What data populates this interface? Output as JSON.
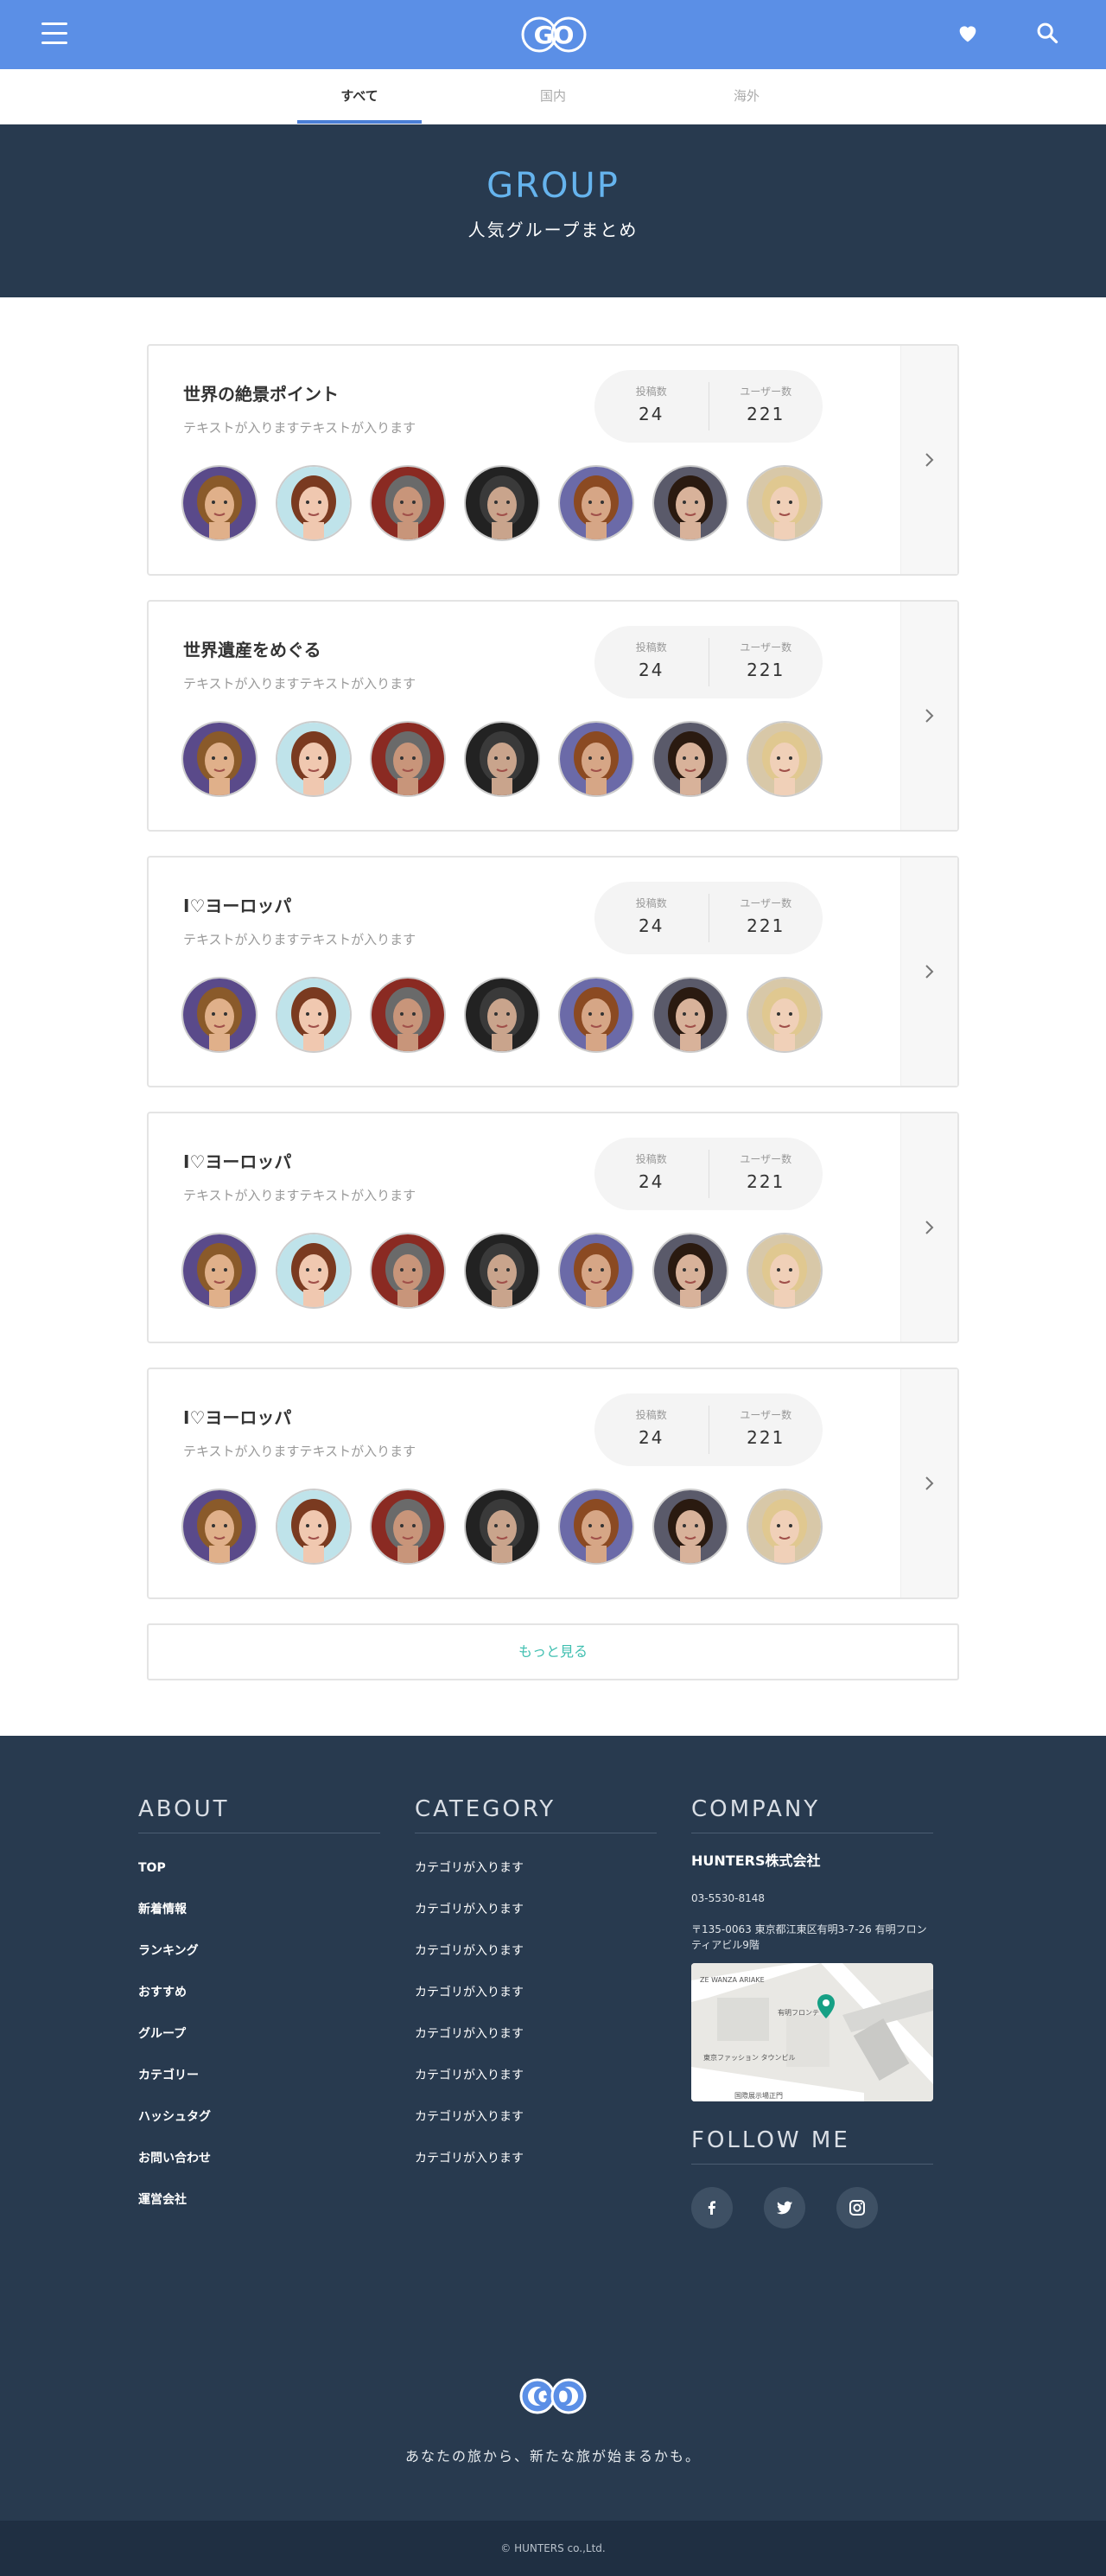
{
  "header": {
    "logo_text": "GO",
    "menu_icon": "hamburger-icon",
    "favorite_icon": "heart-icon",
    "search_icon": "search-icon"
  },
  "tabs": [
    {
      "label": "すべて",
      "active": true
    },
    {
      "label": "国内",
      "active": false
    },
    {
      "label": "海外",
      "active": false
    }
  ],
  "hero": {
    "title": "GROUP",
    "subtitle": "人気グループまとめ"
  },
  "groups": [
    {
      "title": "世界の絶景ポイント",
      "desc": "テキストが入りますテキストが入ります",
      "posts_label": "投稿数",
      "posts": "24",
      "users_label": "ユーザー数",
      "users": "221"
    },
    {
      "title": "世界遺産をめぐる",
      "desc": "テキストが入りますテキストが入ります",
      "posts_label": "投稿数",
      "posts": "24",
      "users_label": "ユーザー数",
      "users": "221"
    },
    {
      "title": "I♡ヨーロッパ",
      "desc": "テキストが入りますテキストが入ります",
      "posts_label": "投稿数",
      "posts": "24",
      "users_label": "ユーザー数",
      "users": "221"
    },
    {
      "title": "I♡ヨーロッパ",
      "desc": "テキストが入りますテキストが入ります",
      "posts_label": "投稿数",
      "posts": "24",
      "users_label": "ユーザー数",
      "users": "221"
    },
    {
      "title": "I♡ヨーロッパ",
      "desc": "テキストが入りますテキストが入ります",
      "posts_label": "投稿数",
      "posts": "24",
      "users_label": "ユーザー数",
      "users": "221"
    }
  ],
  "more_button": "もっと見る",
  "footer": {
    "about": {
      "heading": "ABOUT",
      "links": [
        "TOP",
        "新着情報",
        "ランキング",
        "おすすめ",
        "グループ",
        "カテゴリー",
        "ハッシュタグ",
        "お問い合わせ",
        "運営会社"
      ]
    },
    "category": {
      "heading": "CATEGORY",
      "links": [
        "カテゴリが入ります",
        "カテゴリが入ります",
        "カテゴリが入ります",
        "カテゴリが入ります",
        "カテゴリが入ります",
        "カテゴリが入ります",
        "カテゴリが入ります",
        "カテゴリが入ります"
      ]
    },
    "company": {
      "heading": "COMPANY",
      "name": "HUNTERS株式会社",
      "tel": "03-5530-8148",
      "address": "〒135-0063 東京都江東区有明3-7-26 有明フロンティアビル9階",
      "map_labels": [
        "ZE WANZA ARIAKE",
        "有明フロンテ",
        "東京ファッション タウンビル",
        "国際展示場正門"
      ]
    },
    "follow": {
      "heading": "FOLLOW ME",
      "icons": [
        "facebook-icon",
        "twitter-icon",
        "instagram-icon"
      ]
    },
    "tagline": "あなたの旅から、新たな旅が始まるかも。",
    "copyright": "© HUNTERS co.,Ltd."
  },
  "colors": {
    "header_blue": "#5b8fe6",
    "navy": "#283a4f",
    "hero_title": "#66b4ee",
    "accent_teal": "#3fbfb0"
  }
}
